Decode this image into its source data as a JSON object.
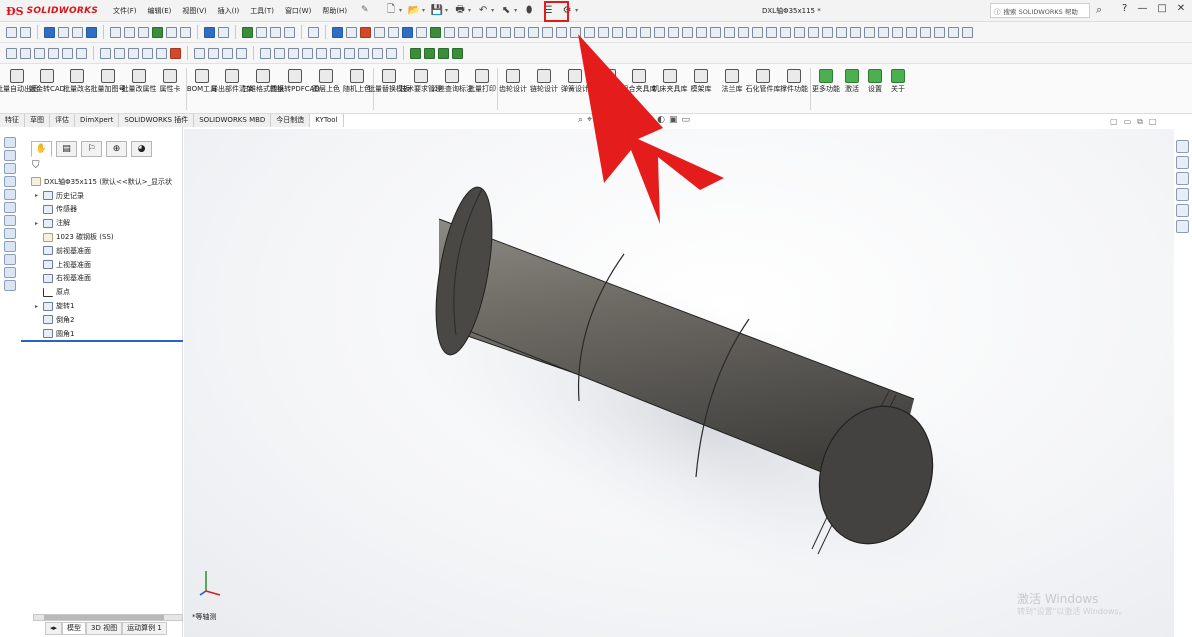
{
  "app": {
    "brand": "SOLIDWORKS",
    "doc_title": "DXL轴Φ35x115 *"
  },
  "menu": [
    "文件(F)",
    "编辑(E)",
    "视图(V)",
    "插入(I)",
    "工具(T)",
    "窗口(W)",
    "帮助(H)"
  ],
  "search": {
    "placeholder": "搜索 SOLIDWORKS 帮助"
  },
  "window_controls": {
    "help": "?",
    "minimize": "—",
    "restore": "□",
    "close": "✕"
  },
  "ribbon": [
    "批量自动出图",
    "钣金转CAD",
    "批量改名",
    "批量加图号",
    "批量改属性",
    "属性卡",
    "BOM工具",
    "导出部件清单",
    "三维格式转换",
    "图纸转PDFCAD",
    "图层上色",
    "随机上色",
    "批量替换模板",
    "技术要求管理",
    "公差查询标注",
    "批量打印",
    "齿轮设计",
    "链轮设计",
    "弹簧设计",
    "标准件库",
    "组合夹具库",
    "机床夹具库",
    "模架库",
    "法兰库",
    "石化管件库",
    "撑件功能",
    "更多功能",
    "激活",
    "设置",
    "关于"
  ],
  "command_tabs": [
    {
      "label": "特征",
      "active": false
    },
    {
      "label": "草图",
      "active": false
    },
    {
      "label": "评估",
      "active": false
    },
    {
      "label": "DimXpert",
      "active": false
    },
    {
      "label": "SOLIDWORKS 插件",
      "active": false
    },
    {
      "label": "SOLIDWORKS MBD",
      "active": false
    },
    {
      "label": "今日制造",
      "active": false
    },
    {
      "label": "KYTool",
      "active": true
    }
  ],
  "feature_tree": {
    "root": "DXL轴Φ35x115 (默认<<默认>_显示状",
    "nodes": [
      {
        "label": "历史记录",
        "expandable": true
      },
      {
        "label": "传感器",
        "expandable": false
      },
      {
        "label": "注解",
        "expandable": true
      },
      {
        "label": "1023 碳钢板 (SS)",
        "expandable": false
      },
      {
        "label": "前视基准面",
        "expandable": false
      },
      {
        "label": "上视基准面",
        "expandable": false
      },
      {
        "label": "右视基准面",
        "expandable": false
      },
      {
        "label": "原点",
        "expandable": false
      },
      {
        "label": "旋转1",
        "expandable": true
      },
      {
        "label": "倒角2",
        "expandable": false
      },
      {
        "label": "圆角1",
        "expandable": false
      }
    ]
  },
  "bottom_tabs": [
    {
      "label": "模型",
      "active": true
    },
    {
      "label": "3D 视图",
      "active": false
    },
    {
      "label": "运动算例 1",
      "active": false
    }
  ],
  "viewport": {
    "view_label": "*等轴测"
  },
  "watermark": {
    "line1": "激活 Windows",
    "line2": "转到\"设置\"以激活 Windows。"
  },
  "colors": {
    "brand_red": "#d9141c",
    "highlight_red": "#e31b1b",
    "shaft_gray": "#6e6b65"
  }
}
